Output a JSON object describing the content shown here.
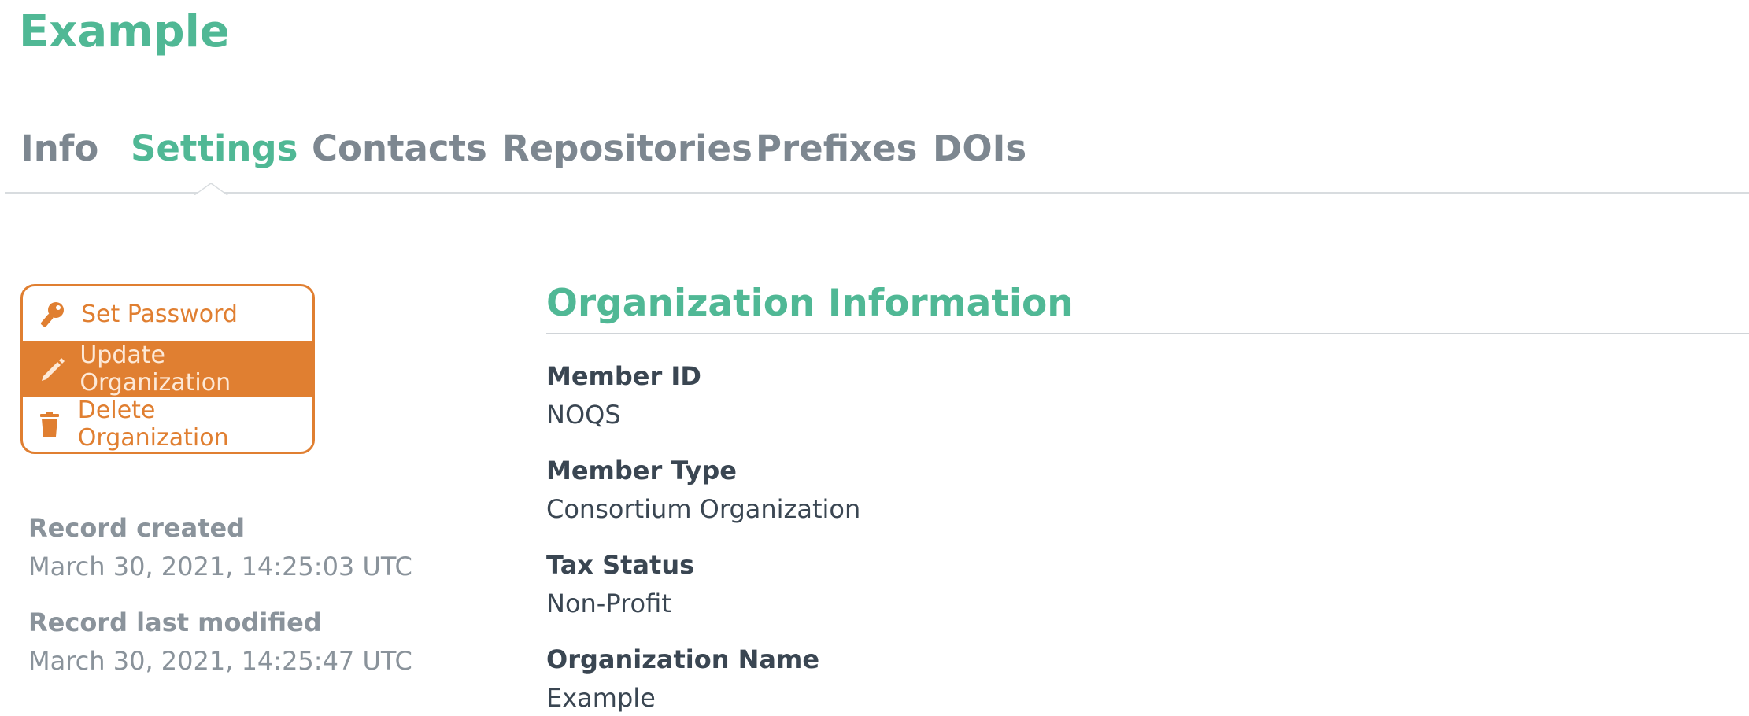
{
  "header": {
    "title": "Example"
  },
  "tabs": [
    {
      "label": "Info"
    },
    {
      "label": "Settings"
    },
    {
      "label": "Contacts"
    },
    {
      "label": "Repositories"
    },
    {
      "label": "Prefixes"
    },
    {
      "label": "DOIs"
    }
  ],
  "active_tab": "Settings",
  "actions": {
    "set_password": {
      "label": "Set Password",
      "icon": "key-icon"
    },
    "update_organization": {
      "label": "Update Organization",
      "icon": "pencil-icon"
    },
    "delete_organization": {
      "label": "Delete Organization",
      "icon": "trash-icon"
    }
  },
  "record": {
    "created_label": "Record created",
    "created_value": "March 30, 2021, 14:25:03 UTC",
    "modified_label": "Record last modified",
    "modified_value": "March 30, 2021, 14:25:47 UTC"
  },
  "organization_info": {
    "title": "Organization Information",
    "fields": [
      {
        "label": "Member ID",
        "value": "NOQS"
      },
      {
        "label": "Member Type",
        "value": "Consortium Organization"
      },
      {
        "label": "Tax Status",
        "value": "Non-Profit"
      },
      {
        "label": "Organization Name",
        "value": "Example"
      }
    ]
  },
  "colors": {
    "accent_green": "#50b895",
    "accent_orange": "#e07f31",
    "text_dark": "#3a4652",
    "text_muted": "#8a939b"
  }
}
